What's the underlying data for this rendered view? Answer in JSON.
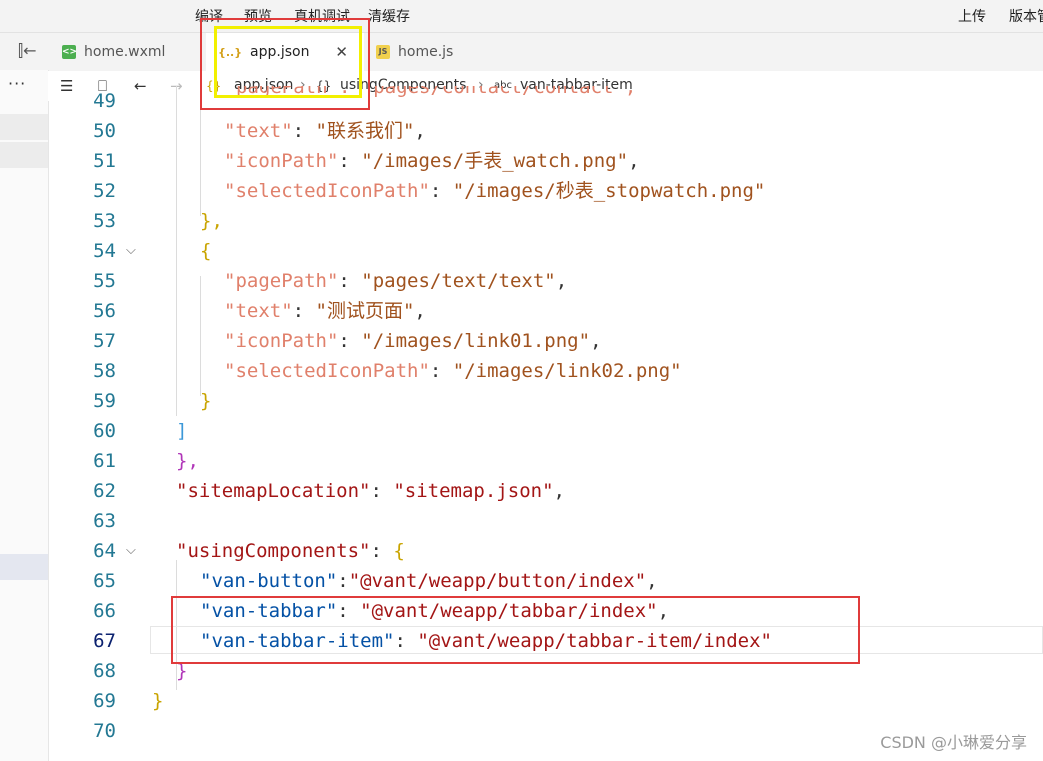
{
  "toolbar": {
    "compile": "编译",
    "preview": "预览",
    "debug": "真机调试",
    "clear_cache": "清缓存",
    "upload": "上传",
    "version": "版本管"
  },
  "tabs": [
    {
      "label": "home.wxml",
      "icon": "wxml-file-icon"
    },
    {
      "label": "app.json",
      "icon": "json-file-icon",
      "active": true
    },
    {
      "label": "home.js",
      "icon": "js-file-icon"
    }
  ],
  "breadcrumb": {
    "file": "app.json",
    "node1": "usingComponents",
    "node2": "van-tabbar-item"
  },
  "left_panel": {
    "more": "···"
  },
  "editor": {
    "lines": [
      {
        "n": "49",
        "text": "pagePath\": \"pages/contact/contact\","
      },
      {
        "n": "50",
        "key": "\"text\"",
        "val": "\"联系我们\""
      },
      {
        "n": "51",
        "key": "\"iconPath\"",
        "val": "\"/images/手表_watch.png\""
      },
      {
        "n": "52",
        "key": "\"selectedIconPath\"",
        "val": "\"/images/秒表_stopwatch.png\""
      },
      {
        "n": "53",
        "text": "},"
      },
      {
        "n": "54",
        "text": "{"
      },
      {
        "n": "55",
        "key": "\"pagePath\"",
        "val": "\"pages/text/text\""
      },
      {
        "n": "56",
        "key": "\"text\"",
        "val": "\"测试页面\""
      },
      {
        "n": "57",
        "key": "\"iconPath\"",
        "val": "\"/images/link01.png\""
      },
      {
        "n": "58",
        "key": "\"selectedIconPath\"",
        "val": "\"/images/link02.png\""
      },
      {
        "n": "59",
        "text": "}"
      },
      {
        "n": "60",
        "text": "]"
      },
      {
        "n": "61",
        "text": "},"
      },
      {
        "n": "62",
        "key": "\"sitemapLocation\"",
        "val": "\"sitemap.json\""
      },
      {
        "n": "63",
        "text": ""
      },
      {
        "n": "64",
        "key": "\"usingComponents\"",
        "text": "{"
      },
      {
        "n": "65",
        "key": "\"van-button\"",
        "val": "\"@vant/weapp/button/index\""
      },
      {
        "n": "66",
        "key": "\"van-tabbar\"",
        "val": "\"@vant/weapp/tabbar/index\""
      },
      {
        "n": "67",
        "key": "\"van-tabbar-item\"",
        "val": "\"@vant/weapp/tabbar-item/index\""
      },
      {
        "n": "68",
        "text": "}"
      },
      {
        "n": "69",
        "text": "}"
      },
      {
        "n": "70",
        "text": ""
      }
    ]
  },
  "watermark": "CSDN @小琳爱分享",
  "colors": {
    "key_light": "#e0806b",
    "string_light": "#a0521e",
    "key_dark": "#0451a5",
    "string_dark": "#a31515",
    "annotation_red": "#e03b3b",
    "annotation_yellow": "#f2f000"
  }
}
